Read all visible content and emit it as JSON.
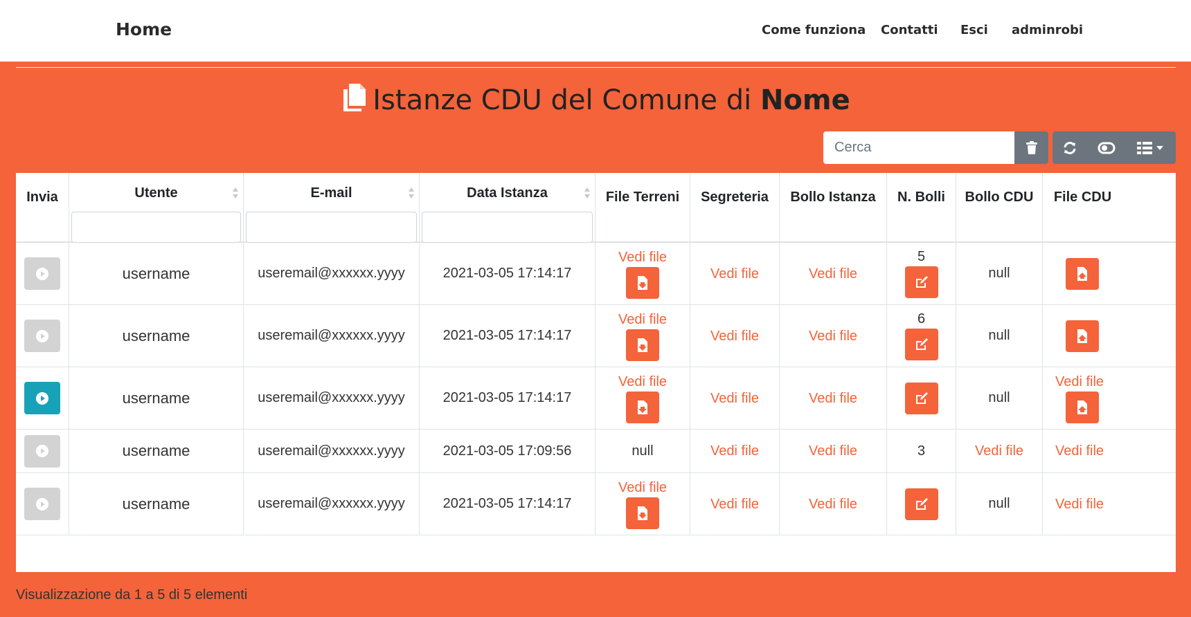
{
  "nav": {
    "brand": "Home",
    "links": [
      "Come funziona",
      "Contatti",
      "Esci",
      "adminrobi"
    ]
  },
  "page": {
    "title_prefix": "Istanze CDU del Comune di",
    "title_bold": "Nome"
  },
  "toolbar": {
    "search_placeholder": "Cerca",
    "icons": [
      "trash-icon",
      "refresh-icon",
      "toggle-icon",
      "columns-icon",
      "caret-down-icon"
    ]
  },
  "table": {
    "columns": [
      "Invia",
      "Utente",
      "E-mail",
      "Data Istanza",
      "File Terreni",
      "Segreteria",
      "Bollo Istanza",
      "N. Bolli",
      "Bollo CDU",
      "File CDU"
    ],
    "rows": [
      {
        "invia_active": false,
        "utente": "username",
        "email": "useremail@xxxxxx.yyyy",
        "data": "2021-03-05 17:14:17",
        "file_terreni": "Vedi file",
        "segreteria": "Vedi file",
        "bollo_istanza": "Vedi file",
        "n_bolli": "5",
        "bollo_cdu": "null",
        "file_cdu": ""
      },
      {
        "invia_active": false,
        "utente": "username",
        "email": "useremail@xxxxxx.yyyy",
        "data": "2021-03-05 17:14:17",
        "file_terreni": "Vedi file",
        "segreteria": "Vedi file",
        "bollo_istanza": "Vedi file",
        "n_bolli": "6",
        "bollo_cdu": "null",
        "file_cdu": ""
      },
      {
        "invia_active": true,
        "utente": "username",
        "email": "useremail@xxxxxx.yyyy",
        "data": "2021-03-05 17:14:17",
        "file_terreni": "Vedi file",
        "segreteria": "Vedi file",
        "bollo_istanza": "Vedi file",
        "n_bolli": "",
        "bollo_cdu": "null",
        "file_cdu": "Vedi file"
      },
      {
        "invia_active": false,
        "utente": "username",
        "email": "useremail@xxxxxx.yyyy",
        "data": "2021-03-05 17:09:56",
        "file_terreni": "null",
        "segreteria": "Vedi file",
        "bollo_istanza": "Vedi file",
        "n_bolli": "3",
        "bollo_cdu": "Vedi file",
        "file_cdu": "Vedi file"
      },
      {
        "invia_active": false,
        "utente": "username",
        "email": "useremail@xxxxxx.yyyy",
        "data": "2021-03-05 17:14:17",
        "file_terreni": "Vedi file",
        "segreteria": "Vedi file",
        "bollo_istanza": "Vedi file",
        "n_bolli": "",
        "bollo_cdu": "null",
        "file_cdu": "Vedi file"
      }
    ]
  },
  "footer": {
    "info": "Visualizzazione da 1 a 5 di 5 elementi"
  },
  "colors": {
    "accent": "#f4633a",
    "active_play": "#17a2b8",
    "inactive_play": "#d3d3d3",
    "toolbar_button": "#6c757d"
  }
}
